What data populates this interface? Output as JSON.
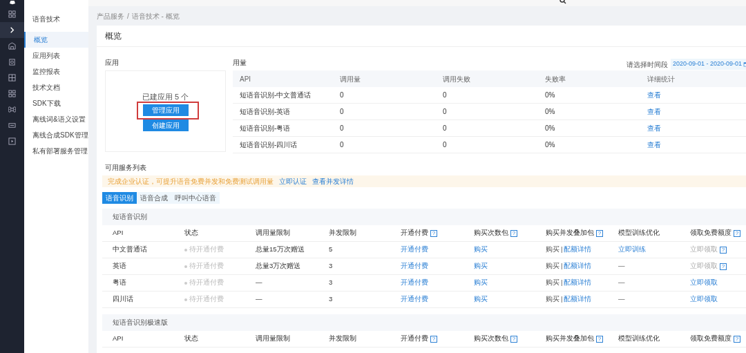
{
  "sidebar": {
    "title": "语音技术",
    "items": [
      {
        "label": "概览",
        "selected": true
      },
      {
        "label": "应用列表",
        "selected": false
      },
      {
        "label": "监控报表",
        "selected": false
      },
      {
        "label": "技术文档",
        "selected": false
      },
      {
        "label": "SDK下载",
        "selected": false
      },
      {
        "label": "离线词&语义设置",
        "selected": false
      },
      {
        "label": "离线合成SDK管理",
        "selected": false
      },
      {
        "label": "私有部署服务管理",
        "selected": false
      }
    ]
  },
  "breadcrumb": [
    "产品服务",
    "/",
    "语音技术 - 概览"
  ],
  "page_title": "概览",
  "apps": {
    "title": "应用",
    "summary": "已建应用 5 个",
    "buttons": [
      {
        "label": "管理应用",
        "highlighted": true
      },
      {
        "label": "创建应用",
        "highlighted": false
      }
    ]
  },
  "usage": {
    "title": "用量",
    "period_label": "请选择时间段",
    "period": "2020-09-01 - 2020-09-01",
    "columns": [
      "API",
      "调用量",
      "调用失败",
      "失败率",
      "详细统计"
    ],
    "rows": [
      {
        "api": "短语音识别-中文普通话",
        "calls": "0",
        "failures": "0",
        "rate": "0%",
        "link": "查看"
      },
      {
        "api": "短语音识别-英语",
        "calls": "0",
        "failures": "0",
        "rate": "0%",
        "link": "查看"
      },
      {
        "api": "短语音识别-粤语",
        "calls": "0",
        "failures": "0",
        "rate": "0%",
        "link": "查看"
      },
      {
        "api": "短语音识别-四川话",
        "calls": "0",
        "failures": "0",
        "rate": "0%",
        "link": "查看"
      }
    ]
  },
  "services": {
    "title": "可用服务列表",
    "notice": {
      "text": "完成企业认证，可提升语音免费并发和免费测试调用量",
      "links": [
        "立即认证",
        "查看并发详情"
      ]
    },
    "tabs": [
      {
        "label": "语音识别",
        "selected": true
      },
      {
        "label": "语音合成",
        "selected": false
      },
      {
        "label": "呼叫中心语音",
        "selected": false
      }
    ],
    "sections": [
      {
        "title": "短语音识别",
        "columns": [
          {
            "label": "API"
          },
          {
            "label": "状态"
          },
          {
            "label": "调用量限制"
          },
          {
            "label": "并发限制"
          },
          {
            "label": "开通付费",
            "help": "?"
          },
          {
            "label": "购买次数包",
            "help": "?"
          },
          {
            "label": "购买并发叠加包",
            "help": "?"
          },
          {
            "label": "模型训练优化"
          },
          {
            "label": "领取免费额度",
            "help": "?"
          }
        ],
        "rows": [
          {
            "api": "中文普通话",
            "status": "待开通付费",
            "quota": "总量15万次赠送",
            "concurrency": "5",
            "pay": "开通付费",
            "buy": "购买",
            "addon": [
              "购买",
              "|",
              "配额详情"
            ],
            "train": {
              "text": "立即训练",
              "kind": "link"
            },
            "free": {
              "text": "立即领取",
              "disabled": true,
              "help": "?"
            }
          },
          {
            "api": "英语",
            "status": "待开通付费",
            "quota": "总量3万次赠送",
            "concurrency": "3",
            "pay": "开通付费",
            "buy": "购买",
            "addon": [
              "购买",
              "|",
              "配额详情"
            ],
            "train": {
              "text": "—",
              "kind": "text"
            },
            "free": {
              "text": "立即领取",
              "disabled": true,
              "help": "?"
            }
          },
          {
            "api": "粤语",
            "status": "待开通付费",
            "quota": "—",
            "concurrency": "3",
            "pay": "开通付费",
            "buy": "购买",
            "addon": [
              "购买",
              "|",
              "配额详情"
            ],
            "train": {
              "text": "—",
              "kind": "text"
            },
            "free": {
              "text": "立即领取",
              "disabled": false
            }
          },
          {
            "api": "四川话",
            "status": "待开通付费",
            "quota": "—",
            "concurrency": "3",
            "pay": "开通付费",
            "buy": "购买",
            "addon": [
              "购买",
              "|",
              "配额详情"
            ],
            "train": {
              "text": "—",
              "kind": "text"
            },
            "free": {
              "text": "立即领取",
              "disabled": false
            }
          }
        ]
      },
      {
        "title": "短语音识别极速版",
        "columns": [
          {
            "label": "API"
          },
          {
            "label": "状态"
          },
          {
            "label": "调用量限制"
          },
          {
            "label": "并发限制"
          },
          {
            "label": "开通付费",
            "help": "?"
          },
          {
            "label": "购买次数包",
            "help": "?"
          },
          {
            "label": "购买并发叠加包",
            "help": "?"
          },
          {
            "label": "模型训练优化"
          },
          {
            "label": "领取免费额度",
            "help": "?"
          }
        ]
      }
    ]
  }
}
